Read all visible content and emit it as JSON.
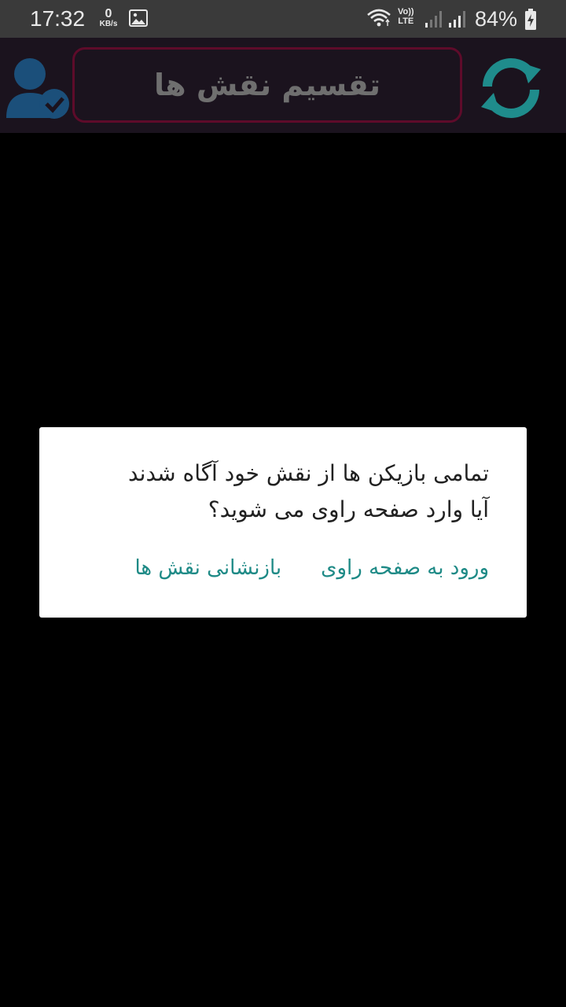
{
  "status_bar": {
    "time": "17:32",
    "net_speed_value": "0",
    "net_speed_unit": "KB/s",
    "network_label_top": "Vo))",
    "network_label_bottom": "LTE",
    "battery": "84%",
    "icons": [
      "gallery-icon",
      "wifi-icon",
      "signal-icon",
      "battery-charging-icon"
    ]
  },
  "toolbar": {
    "title": "تقسیم نقش ها",
    "left_icon": "user-check-icon",
    "right_icon": "refresh-icon",
    "colors": {
      "background": "#1b131e",
      "border": "#5e0b2a",
      "title": "#6f6f6f",
      "user_icon": "#1b4f7a",
      "refresh_icon": "#1f8c8c"
    }
  },
  "dialog": {
    "message": "تمامی بازیکن ها از نقش خود آگاه شدند\nآیا وارد صفحه راوی می شوید؟",
    "positive_label": "ورود به صفحه راوی",
    "negative_label": "بازنشانی نقش ها",
    "colors": {
      "button": "#1e8a86",
      "text": "#212121"
    }
  }
}
